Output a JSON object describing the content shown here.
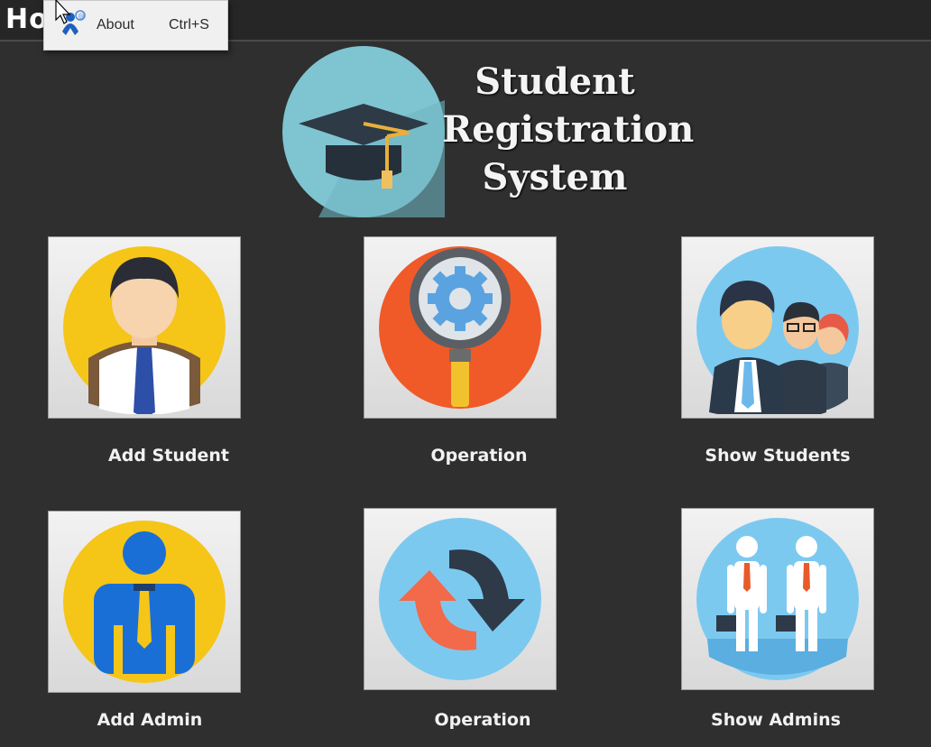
{
  "window": {
    "title_fragment": "Ho"
  },
  "popup_menu": {
    "item_label": "About",
    "item_shortcut": "Ctrl+S",
    "item_icon": "about-person-icon"
  },
  "header": {
    "title_line1": "Student",
    "title_line2": "Registration",
    "title_line3": "System",
    "logo_icon": "graduation-cap-icon"
  },
  "tiles": [
    {
      "label": "Add Student",
      "icon": "student-icon"
    },
    {
      "label": "Operation",
      "icon": "magnifier-gear-icon"
    },
    {
      "label": "Show Students",
      "icon": "group-people-icon"
    },
    {
      "label": "Add Admin",
      "icon": "admin-icon"
    },
    {
      "label": "Operation",
      "icon": "refresh-arrows-icon"
    },
    {
      "label": "Show Admins",
      "icon": "businessmen-icon"
    }
  ],
  "colors": {
    "background": "#2f2f2f",
    "logo_circle": "#7fc4d1",
    "yellow": "#f5c518",
    "orange": "#f05a28",
    "sky_blue": "#7cc9f0"
  }
}
